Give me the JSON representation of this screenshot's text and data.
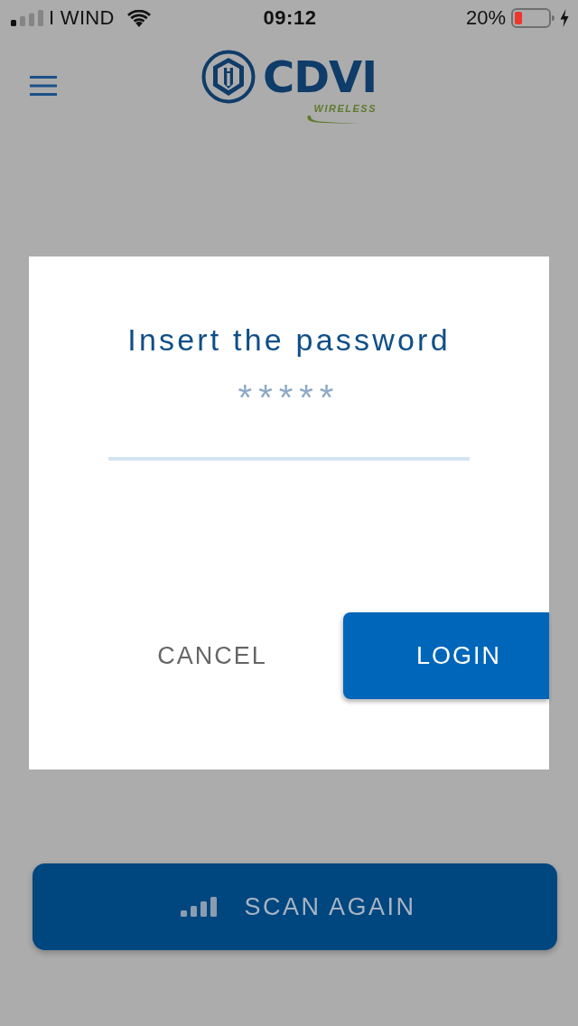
{
  "status_bar": {
    "carrier": "I WIND",
    "time": "09:12",
    "battery": "20%"
  },
  "header": {
    "logo": {
      "name": "CDVI",
      "subtitle": "WIRELESS"
    }
  },
  "dialog": {
    "title": "Insert the password",
    "password_field": {
      "placeholder": "*****"
    },
    "buttons": [
      {
        "label": "CANCEL",
        "kind": "text"
      },
      {
        "label": "LOGIN",
        "kind": "primary"
      }
    ]
  },
  "scan_button": {
    "label": "SCAN AGAIN"
  }
}
